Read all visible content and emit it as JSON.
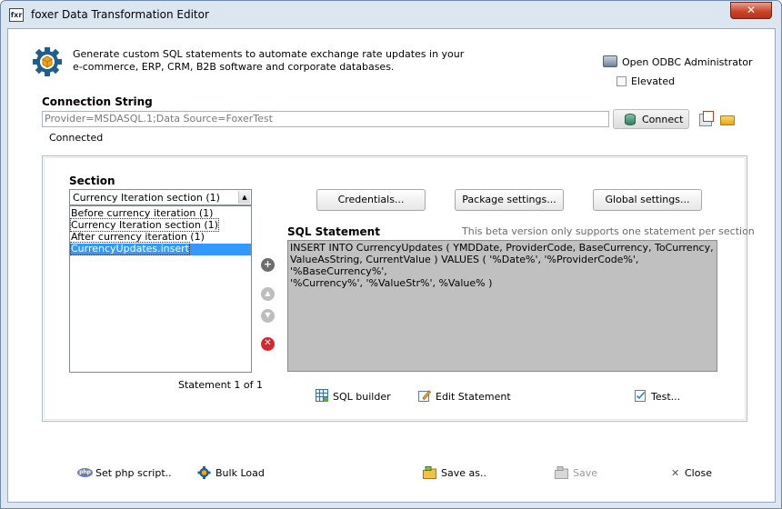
{
  "window": {
    "app_icon_text": "fxr",
    "title": "foxer Data Transformation Editor",
    "close_glyph": "✕"
  },
  "intro": {
    "line1": "Generate custom SQL statements to automate exchange rate updates in your",
    "line2": "e-commerce, ERP, CRM, B2B software and corporate databases."
  },
  "odbc": {
    "label": "Open ODBC Administrator",
    "elevated_label": "Elevated",
    "elevated_checked": false
  },
  "connection": {
    "label": "Connection String",
    "value": "Provider=MSDASQL.1;Data Source=FoxerTest",
    "connect_label": "Connect",
    "status": "Connected"
  },
  "section": {
    "label": "Section",
    "selected": "Currency Iteration section (1)",
    "dropdown_arrow": "▲",
    "items": [
      "Before currency iteration (1)",
      "Currency Iteration section (1)",
      "After currency iteration (1)",
      "CurrencyUpdates.insert"
    ],
    "statement_count": "Statement 1 of 1"
  },
  "buttons": {
    "credentials": "Credentials...",
    "package_settings": "Package settings...",
    "global_settings": "Global settings..."
  },
  "side_icons": {
    "add": "+",
    "up": "▲",
    "down": "▼",
    "delete": "✕"
  },
  "sql": {
    "label": "SQL Statement",
    "note": "This beta version only supports one statement per section",
    "lines": [
      "INSERT INTO CurrencyUpdates ( YMDDate, ProviderCode, BaseCurrency, ToCurrency,",
      "ValueAsString, CurrentValue ) VALUES ( '%Date%', '%ProviderCode%', '%BaseCurrency%',",
      "'%Currency%', '%ValueStr%', %Value% )"
    ]
  },
  "tools": {
    "sql_builder": "SQL builder",
    "edit_statement": "Edit Statement",
    "test": "Test..."
  },
  "footer": {
    "php_badge": "php",
    "set_php": "Set php script..",
    "bulk_load": "Bulk Load",
    "save_as": "Save as..",
    "save": "Save",
    "close_glyph": "✕",
    "close": "Close"
  }
}
